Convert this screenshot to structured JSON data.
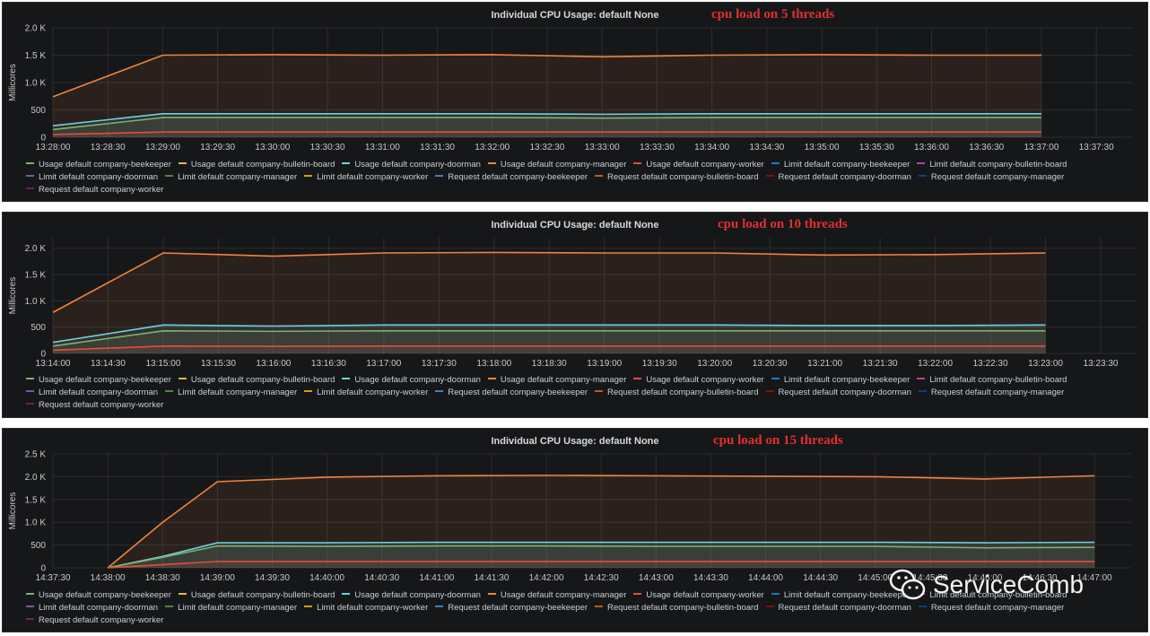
{
  "chart_data": [
    {
      "type": "area",
      "title": "Individual CPU Usage: default None",
      "annotation": "cpu load on 5 threads",
      "ylabel": "Millicores",
      "ylim": [
        0,
        2000
      ],
      "yticks": [
        "0",
        "500",
        "1.0 K",
        "1.5 K",
        "2.0 K"
      ],
      "ytick_values": [
        0,
        500,
        1000,
        1500,
        2000
      ],
      "xlim": [
        "13:28:00",
        "13:37:50"
      ],
      "xticks": [
        "13:28:00",
        "13:28:30",
        "13:29:00",
        "13:29:30",
        "13:30:00",
        "13:30:30",
        "13:31:00",
        "13:31:30",
        "13:32:00",
        "13:32:30",
        "13:33:00",
        "13:33:30",
        "13:34:00",
        "13:34:30",
        "13:35:00",
        "13:35:30",
        "13:36:00",
        "13:36:30",
        "13:37:00",
        "13:37:30"
      ],
      "series": [
        {
          "name": "Usage default company-manager",
          "color": "#ef843c",
          "x": [
            "13:28:00",
            "13:29:00",
            "13:30:00",
            "13:31:00",
            "13:32:00",
            "13:33:00",
            "13:34:00",
            "13:35:00",
            "13:36:00",
            "13:37:00"
          ],
          "values": [
            740,
            1500,
            1510,
            1500,
            1510,
            1470,
            1500,
            1510,
            1500,
            1500
          ]
        },
        {
          "name": "Usage default company-doorman",
          "color": "#6ed0e0",
          "x": [
            "13:28:00",
            "13:29:00",
            "13:30:00",
            "13:31:00",
            "13:32:00",
            "13:33:00",
            "13:34:00",
            "13:35:00",
            "13:36:00",
            "13:37:00"
          ],
          "values": [
            210,
            430,
            430,
            430,
            430,
            420,
            430,
            430,
            430,
            430
          ]
        },
        {
          "name": "Usage default company-beekeeper",
          "color": "#7eb26d",
          "x": [
            "13:28:00",
            "13:29:00",
            "13:30:00",
            "13:31:00",
            "13:32:00",
            "13:33:00",
            "13:34:00",
            "13:35:00",
            "13:36:00",
            "13:37:00"
          ],
          "values": [
            140,
            360,
            360,
            360,
            360,
            350,
            360,
            360,
            360,
            360
          ]
        },
        {
          "name": "Usage default company-worker",
          "color": "#e24d42",
          "x": [
            "13:28:00",
            "13:29:00",
            "13:30:00",
            "13:31:00",
            "13:32:00",
            "13:33:00",
            "13:34:00",
            "13:35:00",
            "13:36:00",
            "13:37:00"
          ],
          "values": [
            50,
            95,
            95,
            95,
            95,
            95,
            95,
            95,
            95,
            95
          ]
        }
      ],
      "legend": [
        {
          "label": "Usage default company-beekeeper",
          "color": "#7eb26d"
        },
        {
          "label": "Usage default company-bulletin-board",
          "color": "#eab839"
        },
        {
          "label": "Usage default company-doorman",
          "color": "#6ed0e0"
        },
        {
          "label": "Usage default company-manager",
          "color": "#ef843c"
        },
        {
          "label": "Usage default company-worker",
          "color": "#e24d42"
        },
        {
          "label": "Limit default company-beekeeper",
          "color": "#1f78c1"
        },
        {
          "label": "Limit default company-bulletin-board",
          "color": "#ba43a9"
        },
        {
          "label": "Limit default company-doorman",
          "color": "#705da0"
        },
        {
          "label": "Limit default company-manager",
          "color": "#508642"
        },
        {
          "label": "Limit default company-worker",
          "color": "#cca300"
        },
        {
          "label": "Request default company-beekeeper",
          "color": "#447ebc"
        },
        {
          "label": "Request default company-bulletin-board",
          "color": "#c15c17"
        },
        {
          "label": "Request default company-doorman",
          "color": "#890f02"
        },
        {
          "label": "Request default company-manager",
          "color": "#0a437c"
        },
        {
          "label": "Request default company-worker",
          "color": "#6d1f62"
        }
      ]
    },
    {
      "type": "area",
      "title": "Individual CPU Usage: default None",
      "annotation": "cpu load on 10 threads",
      "ylabel": "Millicores",
      "ylim": [
        0,
        2200
      ],
      "yticks": [
        "0",
        "500",
        "1.0 K",
        "1.5 K",
        "2.0 K"
      ],
      "ytick_values": [
        0,
        500,
        1000,
        1500,
        2000
      ],
      "xlim": [
        "13:14:00",
        "13:23:50"
      ],
      "xticks": [
        "13:14:00",
        "13:14:30",
        "13:15:00",
        "13:15:30",
        "13:16:00",
        "13:16:30",
        "13:17:00",
        "13:17:30",
        "13:18:00",
        "13:18:30",
        "13:19:00",
        "13:19:30",
        "13:20:00",
        "13:20:30",
        "13:21:00",
        "13:21:30",
        "13:22:00",
        "13:22:30",
        "13:23:00",
        "13:23:30"
      ],
      "series": [
        {
          "name": "Usage default company-manager",
          "color": "#ef843c",
          "x": [
            "13:14:00",
            "13:15:00",
            "13:16:00",
            "13:17:00",
            "13:18:00",
            "13:19:00",
            "13:20:00",
            "13:21:00",
            "13:22:00",
            "13:23:00"
          ],
          "values": [
            780,
            1910,
            1850,
            1910,
            1920,
            1910,
            1910,
            1870,
            1880,
            1910
          ]
        },
        {
          "name": "Usage default company-doorman",
          "color": "#6ed0e0",
          "x": [
            "13:14:00",
            "13:15:00",
            "13:16:00",
            "13:17:00",
            "13:18:00",
            "13:19:00",
            "13:20:00",
            "13:21:00",
            "13:22:00",
            "13:23:00"
          ],
          "values": [
            210,
            540,
            520,
            540,
            540,
            540,
            540,
            530,
            530,
            540
          ]
        },
        {
          "name": "Usage default company-beekeeper",
          "color": "#7eb26d",
          "x": [
            "13:14:00",
            "13:15:00",
            "13:16:00",
            "13:17:00",
            "13:18:00",
            "13:19:00",
            "13:20:00",
            "13:21:00",
            "13:22:00",
            "13:23:00"
          ],
          "values": [
            140,
            430,
            420,
            430,
            430,
            430,
            430,
            430,
            430,
            430
          ]
        },
        {
          "name": "Usage default company-worker",
          "color": "#e24d42",
          "x": [
            "13:14:00",
            "13:15:00",
            "13:16:00",
            "13:17:00",
            "13:18:00",
            "13:19:00",
            "13:20:00",
            "13:21:00",
            "13:22:00",
            "13:23:00"
          ],
          "values": [
            60,
            140,
            135,
            140,
            140,
            140,
            140,
            140,
            140,
            140
          ]
        }
      ],
      "legend": [
        {
          "label": "Usage default company-beekeeper",
          "color": "#7eb26d"
        },
        {
          "label": "Usage default company-bulletin-board",
          "color": "#eab839"
        },
        {
          "label": "Usage default company-doorman",
          "color": "#6ed0e0"
        },
        {
          "label": "Usage default company-manager",
          "color": "#ef843c"
        },
        {
          "label": "Usage default company-worker",
          "color": "#e24d42"
        },
        {
          "label": "Limit default company-beekeeper",
          "color": "#1f78c1"
        },
        {
          "label": "Limit default company-bulletin-board",
          "color": "#ba43a9"
        },
        {
          "label": "Limit default company-doorman",
          "color": "#705da0"
        },
        {
          "label": "Limit default company-manager",
          "color": "#508642"
        },
        {
          "label": "Limit default company-worker",
          "color": "#cca300"
        },
        {
          "label": "Request default company-beekeeper",
          "color": "#447ebc"
        },
        {
          "label": "Request default company-bulletin-board",
          "color": "#c15c17"
        },
        {
          "label": "Request default company-doorman",
          "color": "#890f02"
        },
        {
          "label": "Request default company-manager",
          "color": "#0a437c"
        },
        {
          "label": "Request default company-worker",
          "color": "#6d1f62"
        }
      ]
    },
    {
      "type": "area",
      "title": "Individual CPU Usage: default None",
      "annotation": "cpu load on 15 threads",
      "ylabel": "Millicores",
      "ylim": [
        0,
        2500
      ],
      "yticks": [
        "0",
        "500",
        "1.0 K",
        "1.5 K",
        "2.0 K",
        "2.5 K"
      ],
      "ytick_values": [
        0,
        500,
        1000,
        1500,
        2000,
        2500
      ],
      "xlim": [
        "14:37:30",
        "14:47:20"
      ],
      "xticks": [
        "14:37:30",
        "14:38:00",
        "14:38:30",
        "14:39:00",
        "14:39:30",
        "14:40:00",
        "14:40:30",
        "14:41:00",
        "14:41:30",
        "14:42:00",
        "14:42:30",
        "14:43:00",
        "14:43:30",
        "14:44:00",
        "14:44:30",
        "14:45:00",
        "14:45:30",
        "14:46:00",
        "14:46:30",
        "14:47:00"
      ],
      "series": [
        {
          "name": "Usage default company-manager",
          "color": "#ef843c",
          "x": [
            "14:38:00",
            "14:38:30",
            "14:39:00",
            "14:40:00",
            "14:41:00",
            "14:42:00",
            "14:43:00",
            "14:44:00",
            "14:45:00",
            "14:46:00",
            "14:47:00"
          ],
          "values": [
            0,
            1000,
            1890,
            1990,
            2020,
            2030,
            2020,
            2010,
            2000,
            1950,
            2020
          ]
        },
        {
          "name": "Usage default company-doorman",
          "color": "#6ed0e0",
          "x": [
            "14:38:00",
            "14:38:30",
            "14:39:00",
            "14:40:00",
            "14:41:00",
            "14:42:00",
            "14:43:00",
            "14:44:00",
            "14:45:00",
            "14:46:00",
            "14:47:00"
          ],
          "values": [
            0,
            250,
            550,
            550,
            560,
            560,
            560,
            560,
            560,
            550,
            560
          ]
        },
        {
          "name": "Usage default company-beekeeper",
          "color": "#7eb26d",
          "x": [
            "14:38:00",
            "14:38:30",
            "14:39:00",
            "14:40:00",
            "14:41:00",
            "14:42:00",
            "14:43:00",
            "14:44:00",
            "14:45:00",
            "14:46:00",
            "14:47:00"
          ],
          "values": [
            0,
            230,
            480,
            470,
            480,
            480,
            470,
            470,
            470,
            440,
            450
          ]
        },
        {
          "name": "Usage default company-worker",
          "color": "#e24d42",
          "x": [
            "14:38:00",
            "14:38:30",
            "14:39:00",
            "14:40:00",
            "14:41:00",
            "14:42:00",
            "14:43:00",
            "14:44:00",
            "14:45:00",
            "14:46:00",
            "14:47:00"
          ],
          "values": [
            0,
            70,
            140,
            140,
            140,
            140,
            140,
            140,
            140,
            140,
            140
          ]
        }
      ],
      "legend": [
        {
          "label": "Usage default company-beekeeper",
          "color": "#7eb26d"
        },
        {
          "label": "Usage default company-bulletin-board",
          "color": "#eab839"
        },
        {
          "label": "Usage default company-doorman",
          "color": "#6ed0e0"
        },
        {
          "label": "Usage default company-manager",
          "color": "#ef843c"
        },
        {
          "label": "Usage default company-worker",
          "color": "#e24d42"
        },
        {
          "label": "Limit default company-beekeeper",
          "color": "#1f78c1"
        },
        {
          "label": "Limit default company-bulletin-board",
          "color": "#ba43a9"
        },
        {
          "label": "Limit default company-doorman",
          "color": "#705da0"
        },
        {
          "label": "Limit default company-manager",
          "color": "#508642"
        },
        {
          "label": "Limit default company-worker",
          "color": "#cca300"
        },
        {
          "label": "Request default company-beekeeper",
          "color": "#447ebc"
        },
        {
          "label": "Request default company-bulletin-board",
          "color": "#c15c17"
        },
        {
          "label": "Request default company-doorman",
          "color": "#890f02"
        },
        {
          "label": "Request default company-manager",
          "color": "#0a437c"
        },
        {
          "label": "Request default company-worker",
          "color": "#6d1f62"
        }
      ]
    }
  ],
  "watermark": {
    "text": "ServiceComb",
    "icon": "wechat-icon"
  }
}
